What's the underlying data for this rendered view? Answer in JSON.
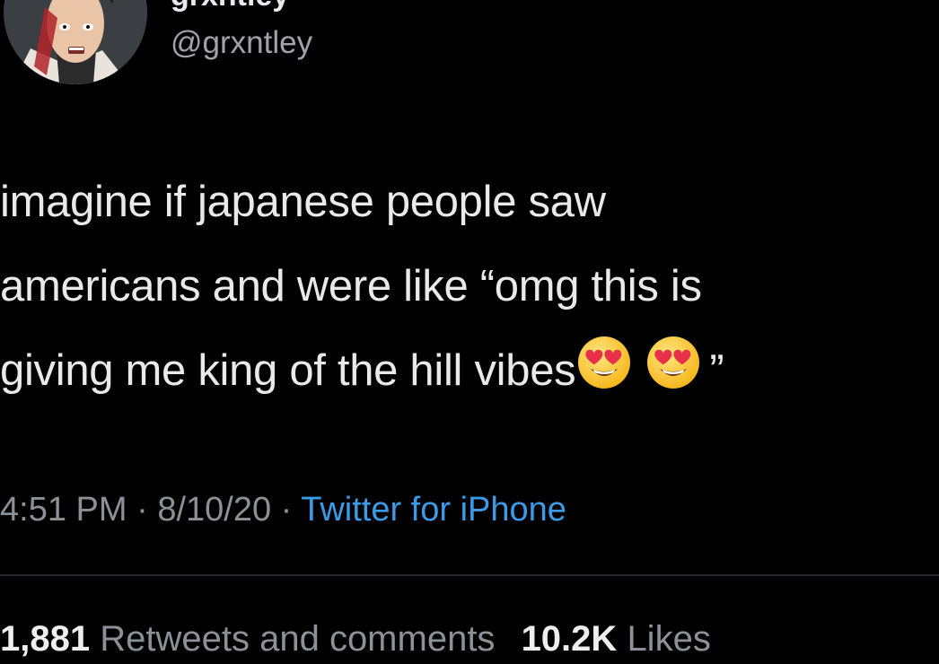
{
  "user": {
    "display_name": "grxntley",
    "handle": "@grxntley"
  },
  "tweet": {
    "lines": [
      "imagine if japanese people saw",
      "americans and were like “omg this is",
      "giving me king of the hill vibes"
    ],
    "emoji": [
      "smiling-face-with-heart-eyes",
      "smiling-face-with-heart-eyes"
    ],
    "closing_quote": "”"
  },
  "meta": {
    "time": "4:51 PM",
    "separator": " · ",
    "date": "8/10/20",
    "source": "Twitter for iPhone"
  },
  "stats": {
    "retweets_count": "1,881",
    "retweets_label": "Retweets and comments",
    "likes_count": "10.2K",
    "likes_label": "Likes"
  },
  "colors": {
    "background": "#000000",
    "text": "#e9e9e9",
    "secondary": "#8b9196",
    "link": "#3a9be8"
  }
}
